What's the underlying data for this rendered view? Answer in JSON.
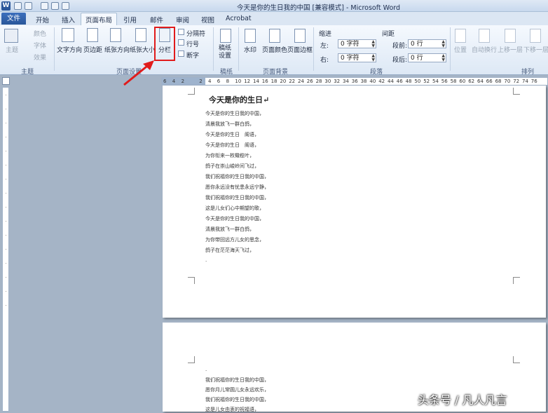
{
  "title_bar": {
    "title": "今天是你的生日我的中国 [兼容模式] - Microsoft Word",
    "app_icon": "W"
  },
  "tabs": [
    "文件",
    "开始",
    "插入",
    "页面布局",
    "引用",
    "邮件",
    "审阅",
    "视图",
    "Acrobat"
  ],
  "ribbon": {
    "theme": {
      "big": "主题",
      "colors": "颜色",
      "fonts": "字体",
      "effects": "效果",
      "group": "主题"
    },
    "page_setup": {
      "text_dir": "文字方向",
      "margins": "页边距",
      "orientation": "纸张方向",
      "size": "纸张大小",
      "columns": "分栏",
      "breaks": "分隔符",
      "line_numbers": "行号",
      "hyphenation": "断字",
      "group": "页面设置"
    },
    "draft": {
      "label": "稿纸设置",
      "group": "稿纸"
    },
    "background": {
      "watermark": "水印",
      "color": "页面颜色",
      "borders": "页面边框",
      "group": "页面背景"
    },
    "paragraph": {
      "indent": "缩进",
      "left": "左:",
      "right": "右:",
      "left_val": "0 字符",
      "right_val": "0 字符",
      "spacing": "间距",
      "before": "段前:",
      "after": "段后:",
      "before_val": "0 行",
      "after_val": "0 行",
      "group": "段落"
    },
    "arrange": {
      "position": "位置",
      "wrap": "自动换行",
      "forward": "上移一层",
      "backward": "下移一层",
      "group": "排列"
    }
  },
  "ruler_numbers": [
    "6",
    "4",
    "2",
    "",
    "2",
    "4",
    "6",
    "8",
    "10",
    "12",
    "14",
    "16",
    "18",
    "20",
    "22",
    "24",
    "26",
    "28",
    "30",
    "32",
    "34",
    "36",
    "38",
    "40",
    "42",
    "44",
    "46",
    "48",
    "50",
    "52",
    "54",
    "56",
    "58",
    "60",
    "62",
    "64",
    "66",
    "68",
    "70",
    "72",
    "74",
    "76"
  ],
  "document": {
    "title": "今天是你的生日↵",
    "page1_lines": [
      "今天是你的生日我的中国，",
      "清晨我放飞一群白鸽，",
      "今天是你的生日　阁语，",
      "今天是你的生日　阁语，",
      "为你衔来一枚橄榄叶，",
      "鸽子在崇山峻岭间飞过，",
      "我们祝福你的生日我的中国，",
      "愿你永远没有忧患永远宁静，",
      "我们祝福你的生日我的中国，",
      "这是儿女们心中期望的歌，",
      "今天是你的生日我的中国，",
      "清晨我放飞一群白鸽，",
      "为你带回远方儿女的思念，",
      "鸽子在茫茫海天飞过，",
      "."
    ],
    "page2_lines": [
      ".",
      "我们祝福你的生日我的中国，",
      "愿你月儿常圆儿女永远欢乐，",
      "我们祝福你的生日我的中国，",
      "这是儿女由衷的祝福语，"
    ]
  },
  "watermark": "头条号 / 凡人凡言"
}
